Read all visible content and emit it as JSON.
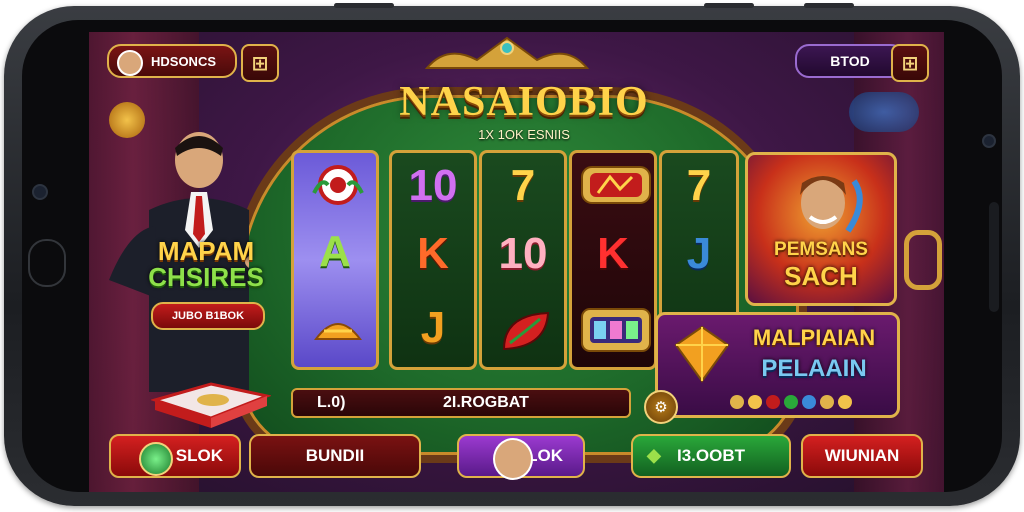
{
  "header": {
    "player_name": "HDSONCS",
    "balance_label": "BTOD",
    "left_icon": "grid-icon",
    "right_icon": "grid-icon"
  },
  "logo": {
    "title": "NASAIOBIO",
    "subtitle": "1X 1OK ESNIIS"
  },
  "left_promo": {
    "line1": "MAPAM",
    "line2": "CHSIRES",
    "badge": "JUBO B1BOK"
  },
  "reels": [
    {
      "symbols": [
        "bingo-ball",
        "A",
        "cake"
      ]
    },
    {
      "symbols": [
        "10",
        "K",
        "J"
      ]
    },
    {
      "symbols": [
        "7",
        "10",
        "leaf"
      ]
    },
    {
      "symbols": [
        "ticket",
        "K",
        "slot-machine"
      ]
    },
    {
      "symbols": [
        "7",
        "J",
        ""
      ]
    }
  ],
  "bonus_cards": {
    "card1_line1": "PEMSANS",
    "card1_line2": "SACH",
    "card2_line1": "MALPIAIAN",
    "card2_line2": "PELAAIN"
  },
  "info_bar": {
    "left": "L.0)",
    "middle": "2I.ROGBAT"
  },
  "bottom_buttons": [
    {
      "label": "SLOK"
    },
    {
      "label": "BUNDII"
    },
    {
      "label": "SLOK"
    },
    {
      "label": "I3.OOBT"
    },
    {
      "label": "WIUNIAN"
    }
  ],
  "colors": {
    "gold": "#e0b34a",
    "felt": "#1e6a2a",
    "accent_red": "#c21c1c",
    "accent_purple": "#9b3ad0",
    "accent_green": "#2aa83a"
  }
}
